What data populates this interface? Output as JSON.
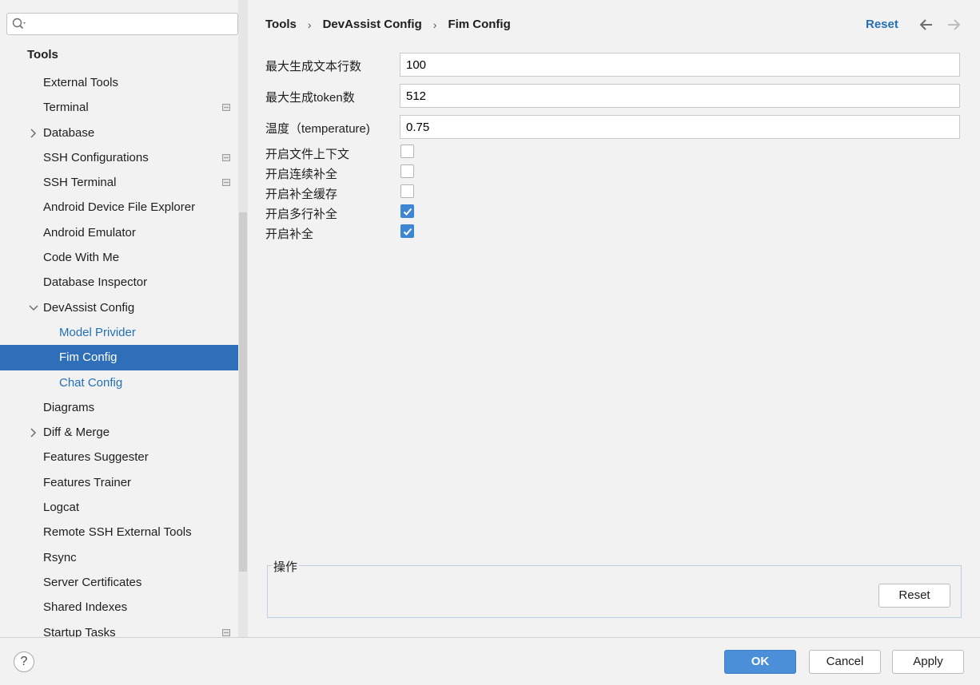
{
  "search": {
    "value": "",
    "placeholder": ""
  },
  "sidebar": {
    "header": "Tools",
    "items": [
      {
        "label": "External Tools",
        "level": 1,
        "arrow": "",
        "project_icon": false,
        "selected": false
      },
      {
        "label": "Terminal",
        "level": 1,
        "arrow": "",
        "project_icon": true,
        "selected": false
      },
      {
        "label": "Database",
        "level": 1,
        "arrow": "collapsed",
        "project_icon": false,
        "selected": false
      },
      {
        "label": "SSH Configurations",
        "level": 1,
        "arrow": "",
        "project_icon": true,
        "selected": false
      },
      {
        "label": "SSH Terminal",
        "level": 1,
        "arrow": "",
        "project_icon": true,
        "selected": false
      },
      {
        "label": "Android Device File Explorer",
        "level": 1,
        "arrow": "",
        "project_icon": false,
        "selected": false
      },
      {
        "label": "Android Emulator",
        "level": 1,
        "arrow": "",
        "project_icon": false,
        "selected": false
      },
      {
        "label": "Code With Me",
        "level": 1,
        "arrow": "",
        "project_icon": false,
        "selected": false
      },
      {
        "label": "Database Inspector",
        "level": 1,
        "arrow": "",
        "project_icon": false,
        "selected": false
      },
      {
        "label": "DevAssist Config",
        "level": 1,
        "arrow": "expanded",
        "project_icon": false,
        "selected": false
      },
      {
        "label": "Model Privider",
        "level": 2,
        "arrow": "",
        "project_icon": false,
        "selected": false
      },
      {
        "label": "Fim Config",
        "level": 2,
        "arrow": "",
        "project_icon": false,
        "selected": true
      },
      {
        "label": "Chat Config",
        "level": 2,
        "arrow": "",
        "project_icon": false,
        "selected": false
      },
      {
        "label": "Diagrams",
        "level": 1,
        "arrow": "",
        "project_icon": false,
        "selected": false
      },
      {
        "label": "Diff & Merge",
        "level": 1,
        "arrow": "collapsed",
        "project_icon": false,
        "selected": false
      },
      {
        "label": "Features Suggester",
        "level": 1,
        "arrow": "",
        "project_icon": false,
        "selected": false
      },
      {
        "label": "Features Trainer",
        "level": 1,
        "arrow": "",
        "project_icon": false,
        "selected": false
      },
      {
        "label": "Logcat",
        "level": 1,
        "arrow": "",
        "project_icon": false,
        "selected": false
      },
      {
        "label": "Remote SSH External Tools",
        "level": 1,
        "arrow": "",
        "project_icon": false,
        "selected": false
      },
      {
        "label": "Rsync",
        "level": 1,
        "arrow": "",
        "project_icon": false,
        "selected": false
      },
      {
        "label": "Server Certificates",
        "level": 1,
        "arrow": "",
        "project_icon": false,
        "selected": false
      },
      {
        "label": "Shared Indexes",
        "level": 1,
        "arrow": "",
        "project_icon": false,
        "selected": false
      },
      {
        "label": "Startup Tasks",
        "level": 1,
        "arrow": "",
        "project_icon": true,
        "selected": false
      }
    ]
  },
  "breadcrumb": [
    "Tools",
    "DevAssist Config",
    "Fim Config"
  ],
  "header": {
    "reset_label": "Reset"
  },
  "form": {
    "fields": [
      {
        "label": "最大生成文本行数",
        "value": "100"
      },
      {
        "label": "最大生成token数",
        "value": "512"
      },
      {
        "label": "温度（temperature)",
        "value": "0.75"
      }
    ],
    "checkboxes": [
      {
        "label": "开启文件上下文",
        "checked": false
      },
      {
        "label": "开启连续补全",
        "checked": false
      },
      {
        "label": "开启补全缓存",
        "checked": false
      },
      {
        "label": "开启多行补全",
        "checked": true
      },
      {
        "label": "开启补全",
        "checked": true
      }
    ]
  },
  "operations": {
    "legend": "操作",
    "reset_label": "Reset"
  },
  "footer": {
    "help_label": "?",
    "ok_label": "OK",
    "cancel_label": "Cancel",
    "apply_label": "Apply"
  },
  "colors": {
    "accent": "#2f6fba",
    "link": "#2470b3",
    "checkbox_checked": "#3d86d4",
    "ok_button": "#4a8fd8"
  },
  "icons": {
    "search": "search-icon",
    "back": "arrow-left-icon",
    "forward": "arrow-right-icon",
    "help": "help-icon"
  }
}
